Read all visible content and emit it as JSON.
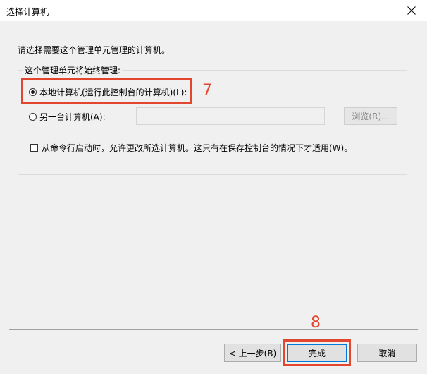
{
  "window": {
    "title": "选择计算机",
    "close_icon": "close-icon"
  },
  "prompt": "请选择需要这个管理单元管理的计算机。",
  "group": {
    "legend": "这个管理单元将始终管理:",
    "local_label": "本地计算机(运行此控制台的计算机)(L):",
    "local_selected": true,
    "remote_label": "另一台计算机(A):",
    "remote_value": "",
    "remote_placeholder": "",
    "browse_label": "浏览(R)...",
    "allow_change_label": "从命令行启动时，允许更改所选计算机。这只有在保存控制台的情况下才适用(W)。",
    "allow_change_checked": false
  },
  "annotations": [
    {
      "number": "7",
      "color": "#e2462e"
    },
    {
      "number": "8",
      "color": "#e2462e"
    }
  ],
  "buttons": {
    "back_label": "< 上一步(B)",
    "finish_label": "完成",
    "cancel_label": "取消"
  },
  "colors": {
    "accent": "#0078d7",
    "annotation": "#e2462e"
  }
}
